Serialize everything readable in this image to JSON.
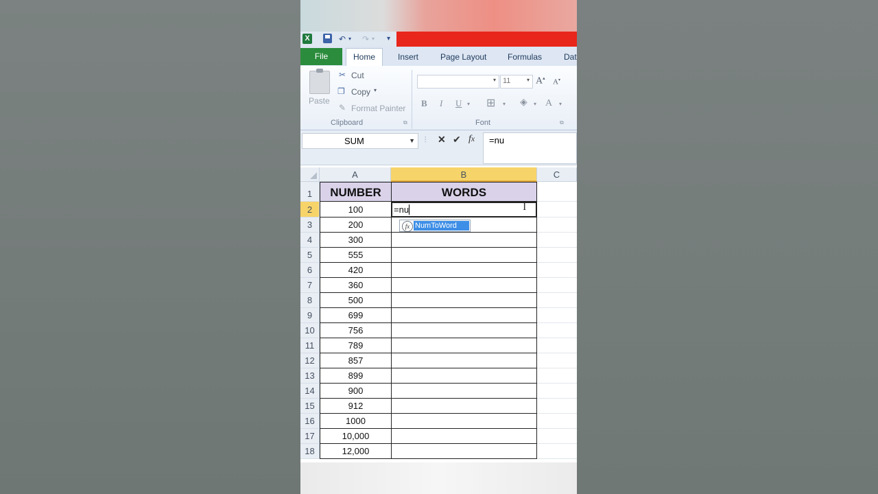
{
  "ribbon_tabs": [
    "File",
    "Home",
    "Insert",
    "Page Layout",
    "Formulas",
    "Dat"
  ],
  "clipboard": {
    "paste": "Paste",
    "cut": "Cut",
    "copy": "Copy",
    "format_painter": "Format Painter",
    "group_label": "Clipboard"
  },
  "font": {
    "size": "11",
    "bold": "B",
    "italic": "I",
    "underline": "U",
    "group_label": "Font"
  },
  "formula_bar": {
    "name_box": "SUM",
    "formula": "=nu"
  },
  "columns": [
    "A",
    "B",
    "C"
  ],
  "rows": [
    "1",
    "2",
    "3",
    "4",
    "5",
    "6",
    "7",
    "8",
    "9",
    "10",
    "11",
    "12",
    "13",
    "14",
    "15",
    "16",
    "17",
    "18"
  ],
  "table": {
    "header_number": "NUMBER",
    "header_words": "WORDS",
    "numbers": [
      "100",
      "200",
      "300",
      "555",
      "420",
      "360",
      "500",
      "699",
      "756",
      "789",
      "857",
      "899",
      "900",
      "912",
      "1000",
      "10,000",
      "12,000"
    ]
  },
  "editing_cell": "=nu",
  "autocomplete": {
    "icon": "fx",
    "suggestion": "NumToWord"
  },
  "colors": {
    "file_tab": "#2a8c3c",
    "header_fill": "#d9d2e9",
    "selected_header": "#f7d46a",
    "autocomplete_highlight": "#3d8ee6"
  }
}
